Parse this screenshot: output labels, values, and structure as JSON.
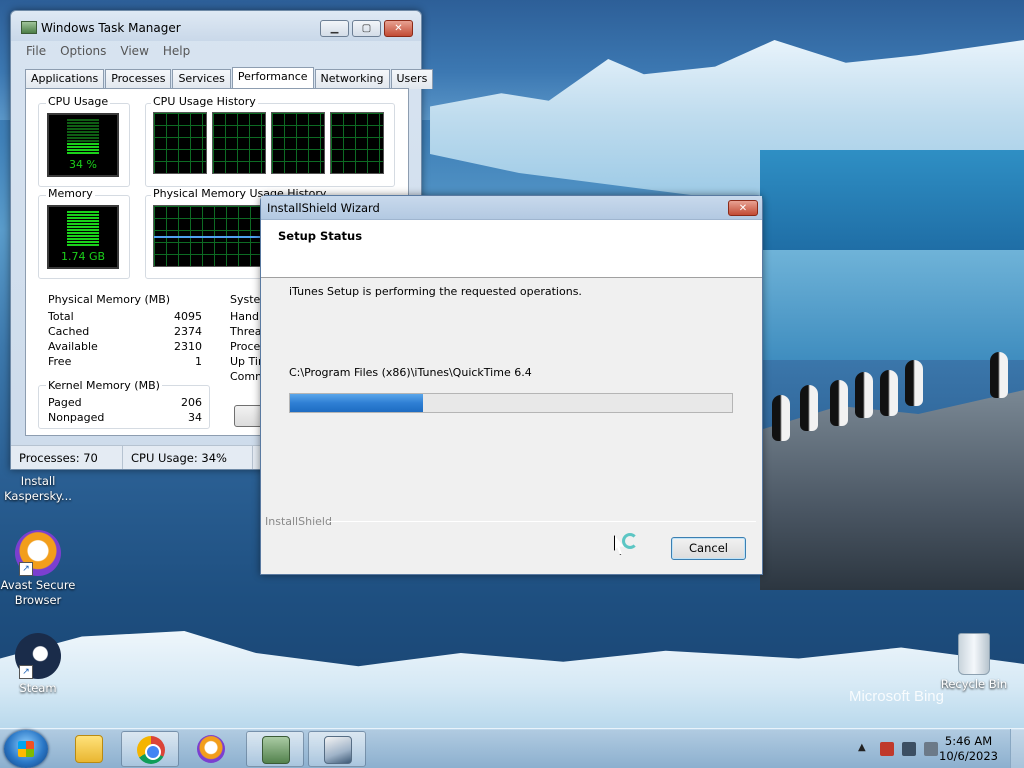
{
  "desktop": {
    "bing_watermark": "Microsoft Bing",
    "icons": [
      {
        "label": "Install Kaspersky..."
      },
      {
        "label": "Avast Secure Browser"
      },
      {
        "label": "Steam"
      },
      {
        "label": "Recycle Bin"
      }
    ]
  },
  "task_manager": {
    "title": "Windows Task Manager",
    "menu": [
      "File",
      "Options",
      "View",
      "Help"
    ],
    "tabs": [
      "Applications",
      "Processes",
      "Services",
      "Performance",
      "Networking",
      "Users"
    ],
    "active_tab": "Performance",
    "cpu_usage_label": "CPU Usage",
    "cpu_usage_value": "34 %",
    "cpu_history_label": "CPU Usage History",
    "memory_label": "Memory",
    "memory_value": "1.74 GB",
    "phys_history_label": "Physical Memory Usage History",
    "physical_memory": {
      "header": "Physical Memory (MB)",
      "rows": [
        {
          "label": "Total",
          "value": "4095"
        },
        {
          "label": "Cached",
          "value": "2374"
        },
        {
          "label": "Available",
          "value": "2310"
        },
        {
          "label": "Free",
          "value": "1"
        }
      ]
    },
    "kernel_memory": {
      "header": "Kernel Memory (MB)",
      "rows": [
        {
          "label": "Paged",
          "value": "206"
        },
        {
          "label": "Nonpaged",
          "value": "34"
        }
      ]
    },
    "system": {
      "header": "System",
      "rows": [
        "Handle",
        "Thread",
        "Proces",
        "Up Tim",
        "Comm"
      ]
    },
    "status": {
      "processes": "Processes: 70",
      "cpu": "CPU Usage: 34%"
    }
  },
  "installshield": {
    "title": "InstallShield Wizard",
    "header_title": "Setup Status",
    "message": "iTunes Setup is performing the requested operations.",
    "current_path": "C:\\Program Files (x86)\\iTunes\\QuickTime 6.4",
    "progress_fraction": 0.3,
    "brand": "InstallShield",
    "cancel_label": "Cancel"
  },
  "taskbar": {
    "clock_time": "5:46 AM",
    "clock_date": "10/6/2023",
    "pinned": [
      "windows-explorer",
      "google-chrome",
      "avast-secure-browser",
      "task-manager",
      "installshield"
    ]
  },
  "colors": {
    "progress_fill": "#2f7fd4",
    "meter_green": "#1bd21b"
  }
}
